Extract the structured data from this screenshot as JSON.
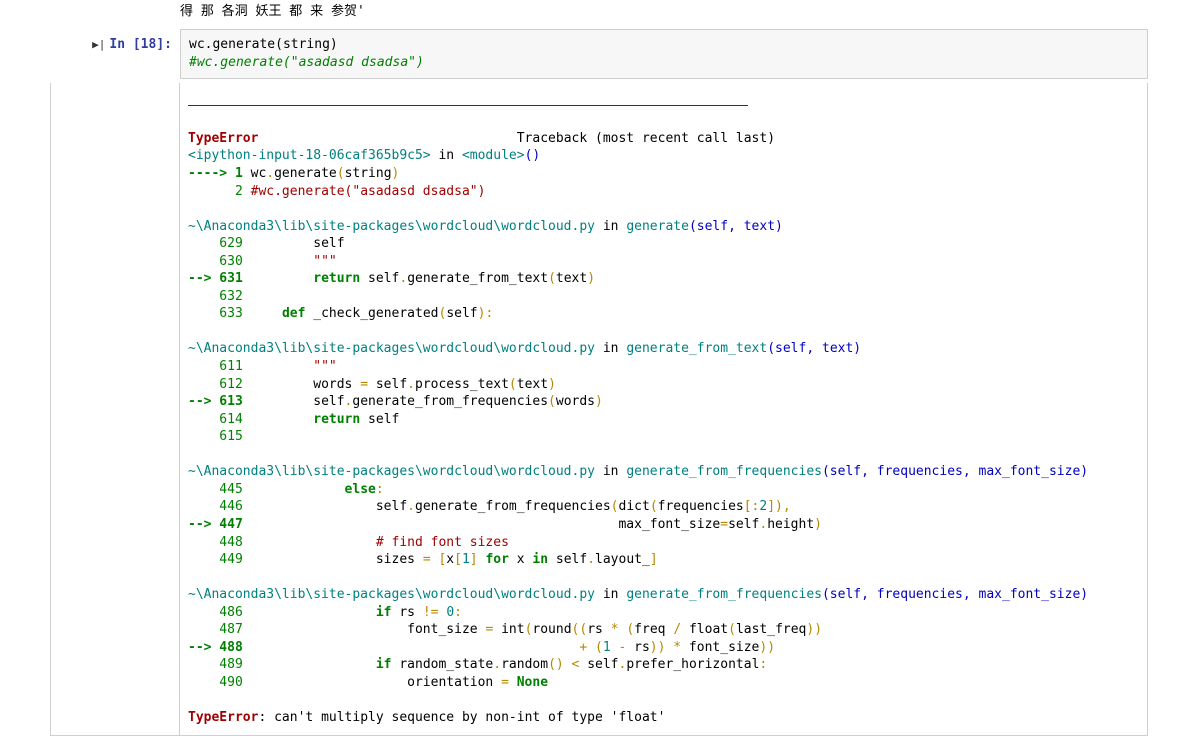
{
  "prev_output": "得 那 各洞 妖王 都 来 参贺'",
  "prompt_label": "In [18]:",
  "input_line1_a": "wc",
  "input_line1_b": "generate",
  "input_line1_c": "string",
  "input_line2": "#wc.generate(\"asadasd dsadsa\")",
  "header_error": "TypeError",
  "header_trace": "Traceback (most recent call last)",
  "ipython_frame_a": "<ipython-input-18-06caf365b9c5>",
  "ipython_frame_b": " in ",
  "ipython_frame_c": "<module>",
  "ipython_frame_d": "()",
  "ip_l1_arrow": "----> 1 ",
  "ip_l1_code": "wc",
  "ip_l1_dot": ".",
  "ip_l1_gen": "generate",
  "ip_l1_open": "(",
  "ip_l1_arg": "string",
  "ip_l1_close": ")",
  "ip_l2_num": "      2 ",
  "ip_l2_code": "#wc.generate(\"asadasd dsadsa\")",
  "f1_path": "~\\Anaconda3\\lib\\site-packages\\wordcloud\\wordcloud.py",
  "f_in": " in ",
  "f1_func": "generate",
  "f1_args": "(self, text)",
  "f1_l629": "    629",
  "f1_l629_code": "         self",
  "f1_l630": "    630",
  "f1_l630_code": "         \"\"\"",
  "f1_l631_arrow": "--> 631",
  "f1_l631_a": "         ",
  "f1_l631_ret": "return",
  "f1_l631_b": " self",
  "f1_l631_c": ".",
  "f1_l631_d": "generate_from_text",
  "f1_l631_e": "(",
  "f1_l631_f": "text",
  "f1_l631_g": ")",
  "f1_l632": "    632",
  "f1_l633": "    633",
  "f1_l633_a": "     ",
  "f1_l633_def": "def",
  "f1_l633_b": " _check_generated",
  "f1_l633_c": "(",
  "f1_l633_d": "self",
  "f1_l633_e": "):",
  "f2_func": "generate_from_text",
  "f2_args": "(self, text)",
  "f2_l611": "    611",
  "f2_l611_code": "         \"\"\"",
  "f2_l612": "    612",
  "f2_l612_a": "         words ",
  "f2_l612_eq": "=",
  "f2_l612_b": " self",
  "f2_l612_c": ".",
  "f2_l612_d": "process_text",
  "f2_l612_e": "(",
  "f2_l612_f": "text",
  "f2_l612_g": ")",
  "f2_l613_arrow": "--> 613",
  "f2_l613_a": "         self",
  "f2_l613_b": ".",
  "f2_l613_c": "generate_from_frequencies",
  "f2_l613_d": "(",
  "f2_l613_e": "words",
  "f2_l613_f": ")",
  "f2_l614": "    614",
  "f2_l614_a": "         ",
  "f2_l614_ret": "return",
  "f2_l614_b": " self",
  "f2_l615": "    615",
  "f3_func": "generate_from_frequencies",
  "f3_args": "(self, frequencies, max_font_size)",
  "f3_l445": "    445",
  "f3_l445_a": "             ",
  "f3_l445_else": "else",
  "f3_l445_b": ":",
  "f3_l446": "    446",
  "f3_l446_a": "                 self",
  "f3_l446_b": ".",
  "f3_l446_c": "generate_from_frequencies",
  "f3_l446_d": "(",
  "f3_l446_e": "dict",
  "f3_l446_f": "(",
  "f3_l446_g": "frequencies",
  "f3_l446_h": "[:",
  "f3_l446_i": "2",
  "f3_l446_j": "]),",
  "f3_l447_arrow": "--> 447",
  "f3_l447_a": "                                                max_font_size",
  "f3_l447_eq": "=",
  "f3_l447_b": "self",
  "f3_l447_c": ".",
  "f3_l447_d": "height",
  "f3_l447_e": ")",
  "f3_l448": "    448",
  "f3_l448_a": "                 ",
  "f3_l448_b": "# find font sizes",
  "f3_l449": "    449",
  "f3_l449_a": "                 sizes ",
  "f3_l449_eq": "=",
  "f3_l449_b": " [",
  "f3_l449_c": "x",
  "f3_l449_d": "[",
  "f3_l449_e": "1",
  "f3_l449_f": "] ",
  "f3_l449_for": "for",
  "f3_l449_g": " x ",
  "f3_l449_in": "in",
  "f3_l449_h": " self",
  "f3_l449_i": ".",
  "f3_l449_j": "layout_",
  "f3_l449_k": "]",
  "f4_l486": "    486",
  "f4_l486_a": "                 ",
  "f4_l486_if": "if",
  "f4_l486_b": " rs ",
  "f4_l486_c": "!=",
  "f4_l486_d": " ",
  "f4_l486_e": "0",
  "f4_l486_f": ":",
  "f4_l487": "    487",
  "f4_l487_a": "                     font_size ",
  "f4_l487_eq": "=",
  "f4_l487_b": " int",
  "f4_l487_c": "(",
  "f4_l487_d": "round",
  "f4_l487_e": "((",
  "f4_l487_f": "rs ",
  "f4_l487_g": "*",
  "f4_l487_h": " (",
  "f4_l487_i": "freq ",
  "f4_l487_j": "/",
  "f4_l487_k": " float",
  "f4_l487_l": "(",
  "f4_l487_m": "last_freq",
  "f4_l487_n": "))",
  "f4_l488_arrow": "--> 488",
  "f4_l488_a": "                                           ",
  "f4_l488_b": "+",
  "f4_l488_c": " (",
  "f4_l488_d": "1",
  "f4_l488_e": " ",
  "f4_l488_f": "-",
  "f4_l488_g": " rs",
  "f4_l488_h": ")) ",
  "f4_l488_i": "*",
  "f4_l488_j": " font_size",
  "f4_l488_k": "))",
  "f4_l489": "    489",
  "f4_l489_a": "                 ",
  "f4_l489_if": "if",
  "f4_l489_b": " random_state",
  "f4_l489_c": ".",
  "f4_l489_d": "random",
  "f4_l489_e": "() ",
  "f4_l489_f": "<",
  "f4_l489_g": " self",
  "f4_l489_h": ".",
  "f4_l489_i": "prefer_horizontal",
  "f4_l489_j": ":",
  "f4_l490": "    490",
  "f4_l490_a": "                     orientation ",
  "f4_l490_eq": "=",
  "f4_l490_b": " ",
  "f4_l490_none": "None",
  "final_err_type": "TypeError",
  "final_err_sep": ": ",
  "final_err_msg": "can't multiply sequence by non-int of type 'float'"
}
